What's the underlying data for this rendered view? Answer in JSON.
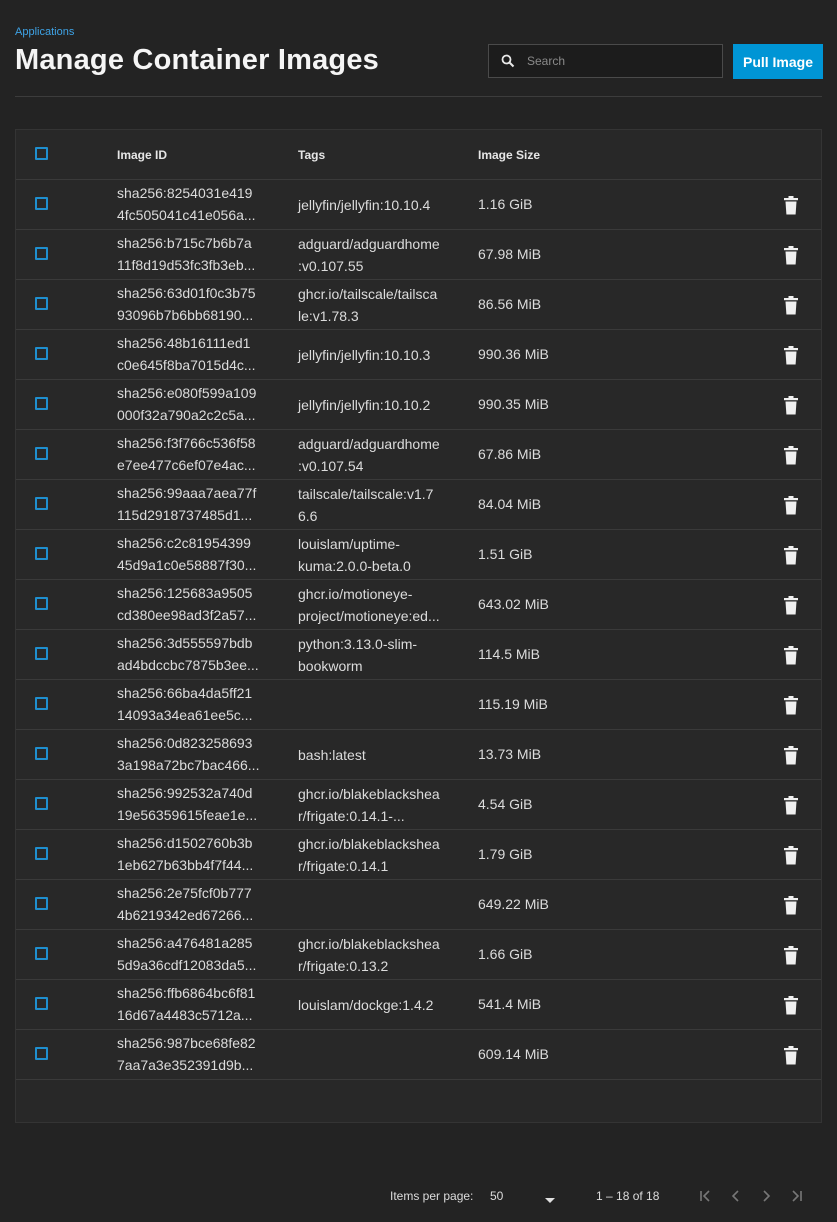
{
  "breadcrumb": "Applications",
  "page_title": "Manage Container Images",
  "search": {
    "placeholder": "Search",
    "value": ""
  },
  "pull_button": "Pull Image",
  "columns": {
    "image_id": "Image ID",
    "tags": "Tags",
    "image_size": "Image Size"
  },
  "rows": [
    {
      "id1": "sha256:8254031e419",
      "id2": "4fc505041c41e056a...",
      "tag1": "jellyfin/jellyfin:10.10.4",
      "tag2": "",
      "size": "1.16 GiB"
    },
    {
      "id1": "sha256:b715c7b6b7a",
      "id2": "11f8d19d53fc3fb3eb...",
      "tag1": "adguard/adguardhome",
      "tag2": ":v0.107.55",
      "size": "67.98 MiB"
    },
    {
      "id1": "sha256:63d01f0c3b75",
      "id2": "93096b7b6bb68190...",
      "tag1": "ghcr.io/tailscale/tailsca",
      "tag2": "le:v1.78.3",
      "size": "86.56 MiB"
    },
    {
      "id1": "sha256:48b16111ed1",
      "id2": "c0e645f8ba7015d4c...",
      "tag1": "jellyfin/jellyfin:10.10.3",
      "tag2": "",
      "size": "990.36 MiB"
    },
    {
      "id1": "sha256:e080f599a109",
      "id2": "000f32a790a2c2c5a...",
      "tag1": "jellyfin/jellyfin:10.10.2",
      "tag2": "",
      "size": "990.35 MiB"
    },
    {
      "id1": "sha256:f3f766c536f58",
      "id2": "e7ee477c6ef07e4ac...",
      "tag1": "adguard/adguardhome",
      "tag2": ":v0.107.54",
      "size": "67.86 MiB"
    },
    {
      "id1": "sha256:99aaa7aea77f",
      "id2": "115d2918737485d1...",
      "tag1": "tailscale/tailscale:v1.7",
      "tag2": "6.6",
      "size": "84.04 MiB"
    },
    {
      "id1": "sha256:c2c81954399",
      "id2": "45d9a1c0e58887f30...",
      "tag1": "louislam/uptime-",
      "tag2": "kuma:2.0.0-beta.0",
      "size": "1.51 GiB"
    },
    {
      "id1": "sha256:125683a9505",
      "id2": "cd380ee98ad3f2a57...",
      "tag1": "ghcr.io/motioneye-",
      "tag2": "project/motioneye:ed...",
      "size": "643.02 MiB"
    },
    {
      "id1": "sha256:3d555597bdb",
      "id2": "ad4bdccbc7875b3ee...",
      "tag1": "python:3.13.0-slim-",
      "tag2": "bookworm",
      "size": "114.5 MiB"
    },
    {
      "id1": "sha256:66ba4da5ff21",
      "id2": "14093a34ea61ee5c...",
      "tag1": "",
      "tag2": "",
      "size": "115.19 MiB"
    },
    {
      "id1": "sha256:0d823258693",
      "id2": "3a198a72bc7bac466...",
      "tag1": "bash:latest",
      "tag2": "",
      "size": "13.73 MiB"
    },
    {
      "id1": "sha256:992532a740d",
      "id2": "19e56359615feae1e...",
      "tag1": "ghcr.io/blakeblackshea",
      "tag2": "r/frigate:0.14.1-...",
      "size": "4.54 GiB"
    },
    {
      "id1": "sha256:d1502760b3b",
      "id2": "1eb627b63bb4f7f44...",
      "tag1": "ghcr.io/blakeblackshea",
      "tag2": "r/frigate:0.14.1",
      "size": "1.79 GiB"
    },
    {
      "id1": "sha256:2e75fcf0b777",
      "id2": "4b6219342ed67266...",
      "tag1": "",
      "tag2": "",
      "size": "649.22 MiB"
    },
    {
      "id1": "sha256:a476481a285",
      "id2": "5d9a36cdf12083da5...",
      "tag1": "ghcr.io/blakeblackshea",
      "tag2": "r/frigate:0.13.2",
      "size": "1.66 GiB"
    },
    {
      "id1": "sha256:ffb6864bc6f81",
      "id2": "16d67a4483c5712a...",
      "tag1": "louislam/dockge:1.4.2",
      "tag2": "",
      "size": "541.4 MiB"
    },
    {
      "id1": "sha256:987bce68fe82",
      "id2": "7aa7a3e352391d9b...",
      "tag1": "",
      "tag2": "",
      "size": "609.14 MiB"
    }
  ],
  "pagination": {
    "items_per_page_label": "Items per page:",
    "items_per_page": "50",
    "range": "1 – 18 of 18"
  },
  "colors": {
    "accent": "#0095d5",
    "background": "#232323",
    "card": "#282828"
  }
}
